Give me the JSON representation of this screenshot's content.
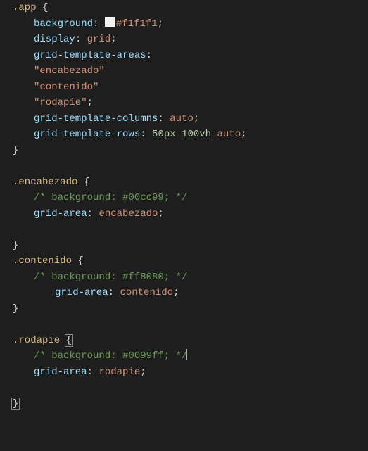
{
  "code": {
    "app": {
      "selector": ".app",
      "props": {
        "bg_prop": "background",
        "bg_val": "#f1f1f1",
        "display_prop": "display",
        "display_val": "grid",
        "gta_prop": "grid-template-areas",
        "gta_v1": "\"encabezado\"",
        "gta_v2": "\"contenido\"",
        "gta_v3": "\"rodapie\"",
        "gtc_prop": "grid-template-columns",
        "gtc_val": "auto",
        "gtr_prop": "grid-template-rows",
        "gtr_v1": "50px",
        "gtr_v2": "100vh",
        "gtr_v3": "auto"
      }
    },
    "encabezado": {
      "selector": ".encabezado",
      "comment": "/* background: #00cc99; */",
      "ga_prop": "grid-area",
      "ga_val": "encabezado"
    },
    "contenido": {
      "selector": ".contenido",
      "comment": "/* background: #ff8080; */",
      "ga_prop": "grid-area",
      "ga_val": "contenido"
    },
    "rodapie": {
      "selector": ".rodapie",
      "comment": "/* background: #0099ff; */",
      "ga_prop": "grid-area",
      "ga_val": "rodapie"
    }
  },
  "colors": {
    "swatch_f1": "#f1f1f1"
  },
  "punct": {
    "open": "{",
    "close": "}",
    "colon": ":",
    "semi": ";",
    "sp": " "
  }
}
